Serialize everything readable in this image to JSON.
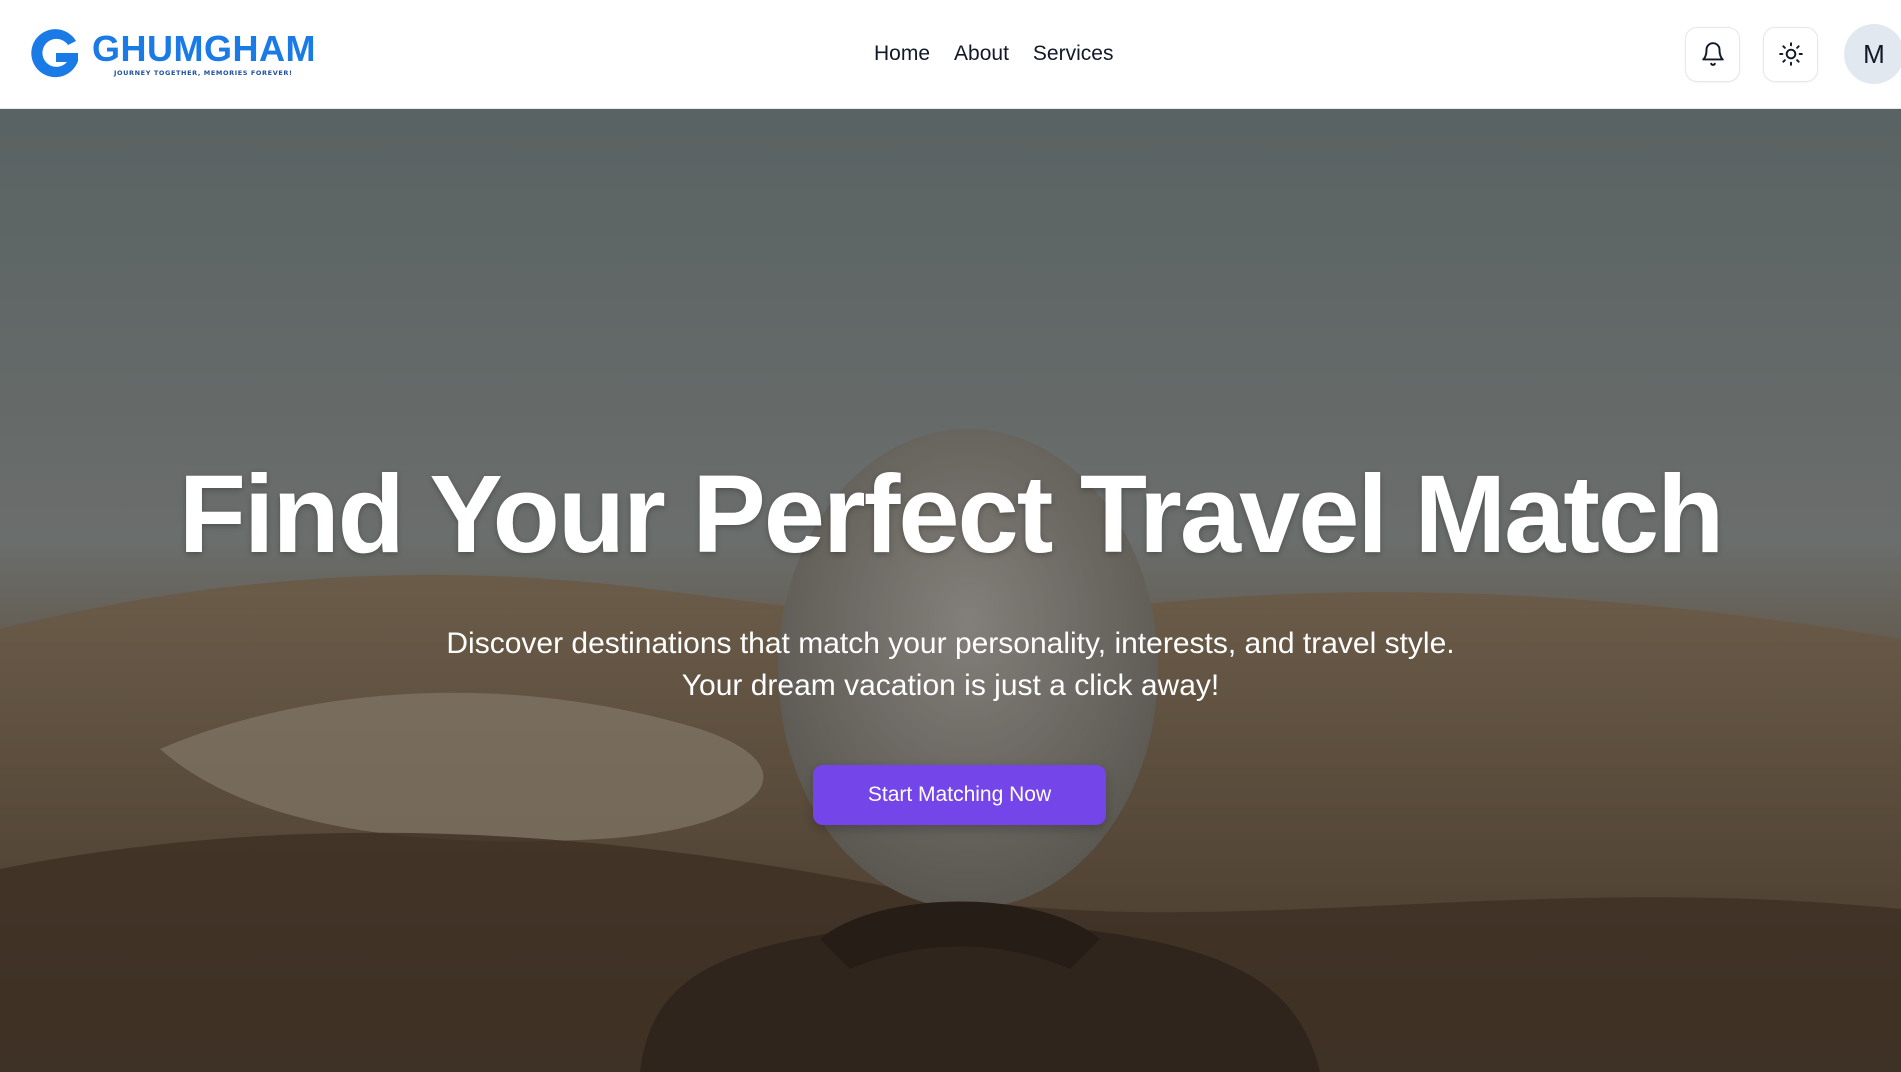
{
  "brand": {
    "name": "GHUMGHAM",
    "tagline": "JOURNEY TOGETHER, MEMORIES FOREVER!",
    "logo_letter": "G",
    "color": "#1a7ae6"
  },
  "nav": {
    "items": [
      {
        "label": "Home"
      },
      {
        "label": "About"
      },
      {
        "label": "Services"
      }
    ]
  },
  "actions": {
    "notifications_icon": "bell-icon",
    "theme_icon": "sun-icon",
    "avatar_initial": "M"
  },
  "hero": {
    "title": "Find Your Perfect Travel Match",
    "subtitle_line1": "Discover destinations that match your personality, interests, and travel style.",
    "subtitle_line2": "Your dream vacation is just a click away!",
    "cta_label": "Start Matching Now",
    "cta_color": "#7445e8",
    "background_description_icon": "hero-photo"
  }
}
